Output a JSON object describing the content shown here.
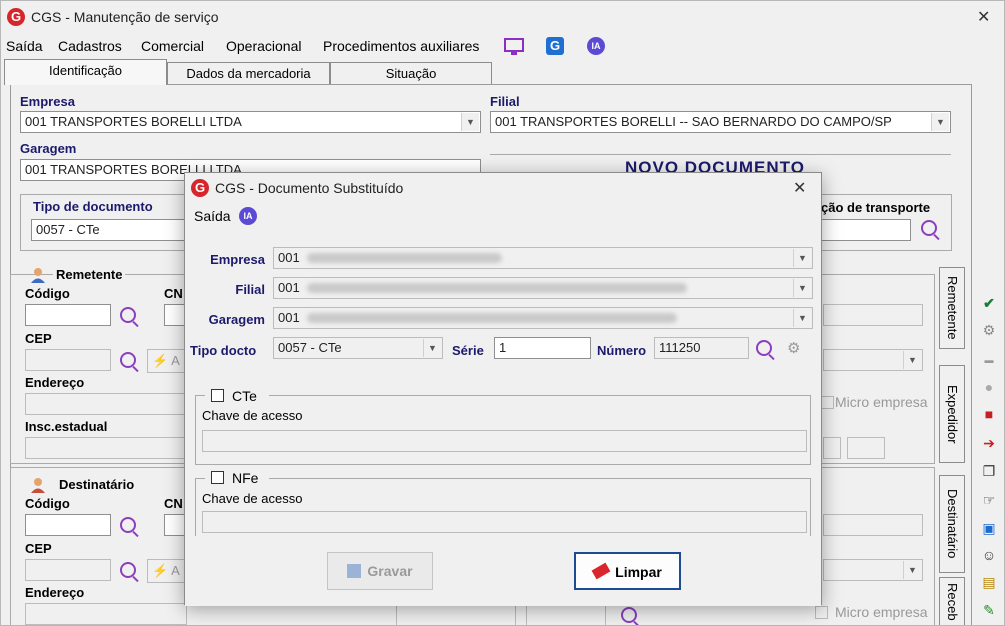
{
  "window": {
    "title": "CGS - Manutenção de serviço",
    "close": "✕"
  },
  "menu": {
    "items": [
      "Saída",
      "Cadastros",
      "Comercial",
      "Operacional",
      "Procedimentos auxiliares"
    ],
    "ia": "IA"
  },
  "tabs": [
    "Identificação",
    "Dados da mercadoria",
    "Situação"
  ],
  "form": {
    "empresa_label": "Empresa",
    "empresa_value": "001 TRANSPORTES BORELLI LTDA",
    "filial_label": "Filial",
    "filial_value": "001 TRANSPORTES BORELLI -- SAO BERNARDO DO CAMPO/SP",
    "garagem_label": "Garagem",
    "garagem_value": "001 TRANSPORTES BORELLI LTDA",
    "novo_documento": "NOVO DOCUMENTO",
    "tipo_label": "Tipo de documento",
    "tipo_value": "0057 - CTe",
    "transporte_label": "ção de transporte"
  },
  "remetente": {
    "title": "Remetente",
    "codigo": "Código",
    "cn": "CN",
    "cep": "CEP",
    "a": "A",
    "endereco": "Endereço",
    "inscricao": "Insc.estadual",
    "micro": "Micro empresa"
  },
  "destinatario": {
    "title": "Destinatário",
    "codigo": "Código",
    "cn": "CN",
    "cep": "CEP",
    "a": "A",
    "endereco": "Endereço",
    "micro": "Micro empresa"
  },
  "side_tabs": [
    "Remetente",
    "Expedidor",
    "Destinatário",
    "Receb"
  ],
  "modal": {
    "title": "CGS - Documento Substituído",
    "close": "✕",
    "menu_saida": "Saída",
    "ia": "IA",
    "empresa_label": "Empresa",
    "empresa_value": "001",
    "filial_label": "Filial",
    "filial_value": "001",
    "garagem_label": "Garagem",
    "garagem_value": "001",
    "tipo_label": "Tipo docto",
    "tipo_value": "0057 - CTe",
    "serie_label": "Série",
    "serie_value": "1",
    "numero_label": "Número",
    "numero_value": "111250",
    "cte_label": "CTe",
    "nfe_label": "NFe",
    "chave_label": "Chave de acesso",
    "gravar": "Gravar",
    "limpar": "Limpar"
  }
}
